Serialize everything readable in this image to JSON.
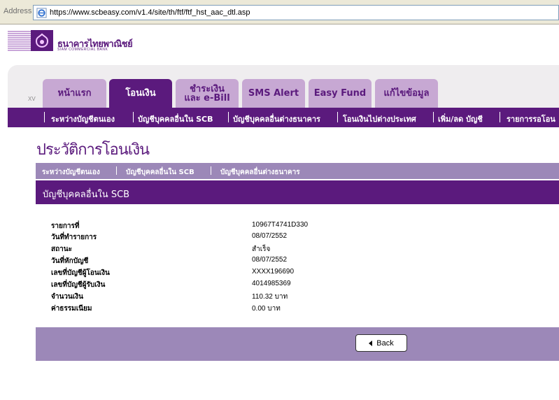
{
  "browser": {
    "address_label": "Address",
    "url": "https://www.scbeasy.com/v1.4/site/th/ftf/ftf_hst_aac_dtl.asp"
  },
  "logo": {
    "name_th": "ธนาคารไทยพาณิชย์",
    "name_en": "SIAM COMMERCIAL BANK"
  },
  "header": {
    "version": "XV",
    "tabs": [
      {
        "label": "หน้าแรก"
      },
      {
        "label": "โอนเงิน",
        "active": true
      },
      {
        "label": "ชำระเงิน\nและ e-Bill"
      },
      {
        "label": "SMS Alert"
      },
      {
        "label": "Easy Fund"
      },
      {
        "label": "แก้ไขข้อมูล"
      }
    ]
  },
  "subnav": {
    "items": [
      {
        "label": "ระหว่างบัญชีตนเอง"
      },
      {
        "label": "บัญชีบุคคลอื่นใน SCB"
      },
      {
        "label": "บัญชีบุคคลอื่นต่างธนาคาร"
      },
      {
        "label": "โอนเงินไปต่างประเทศ"
      },
      {
        "label": "เพิ่ม/ลด บัญชี"
      },
      {
        "label": "รายการรอโอน"
      }
    ]
  },
  "page_title": "ประวัติการโอนเงิน",
  "breadcrumbs": [
    {
      "label": "ระหว่างบัญชีตนเอง"
    },
    {
      "label": "บัญชีบุคคลอื่นใน SCB"
    },
    {
      "label": "บัญชีบุคคลอื่นต่างธนาคาร"
    }
  ],
  "section_title": "บัญชีบุคคลอื่นใน SCB",
  "details": [
    {
      "label": "รายการที่",
      "value": "10967T4741D330"
    },
    {
      "label": "วันที่ทำรายการ",
      "value": "08/07/2552"
    },
    {
      "label": "สถานะ",
      "value": "สำเร็จ"
    },
    {
      "label": "วันที่หักบัญชี",
      "value": "08/07/2552"
    },
    {
      "label": "เลขที่บัญชีผู้โอนเงิน",
      "value": "XXXX196690"
    },
    {
      "label": "เลขที่บัญชีผู้รับเงิน",
      "value": "4014985369"
    },
    {
      "label": "จำนวนเงิน",
      "value": "110.32 บาท"
    },
    {
      "label": "ค่าธรรมเนียม",
      "value": "0.00 บาท"
    }
  ],
  "back_button": "Back",
  "colors": {
    "brand_purple": "#5b1a7d",
    "light_purple": "#c7a8d3",
    "bar_purple": "#9c88b8"
  }
}
